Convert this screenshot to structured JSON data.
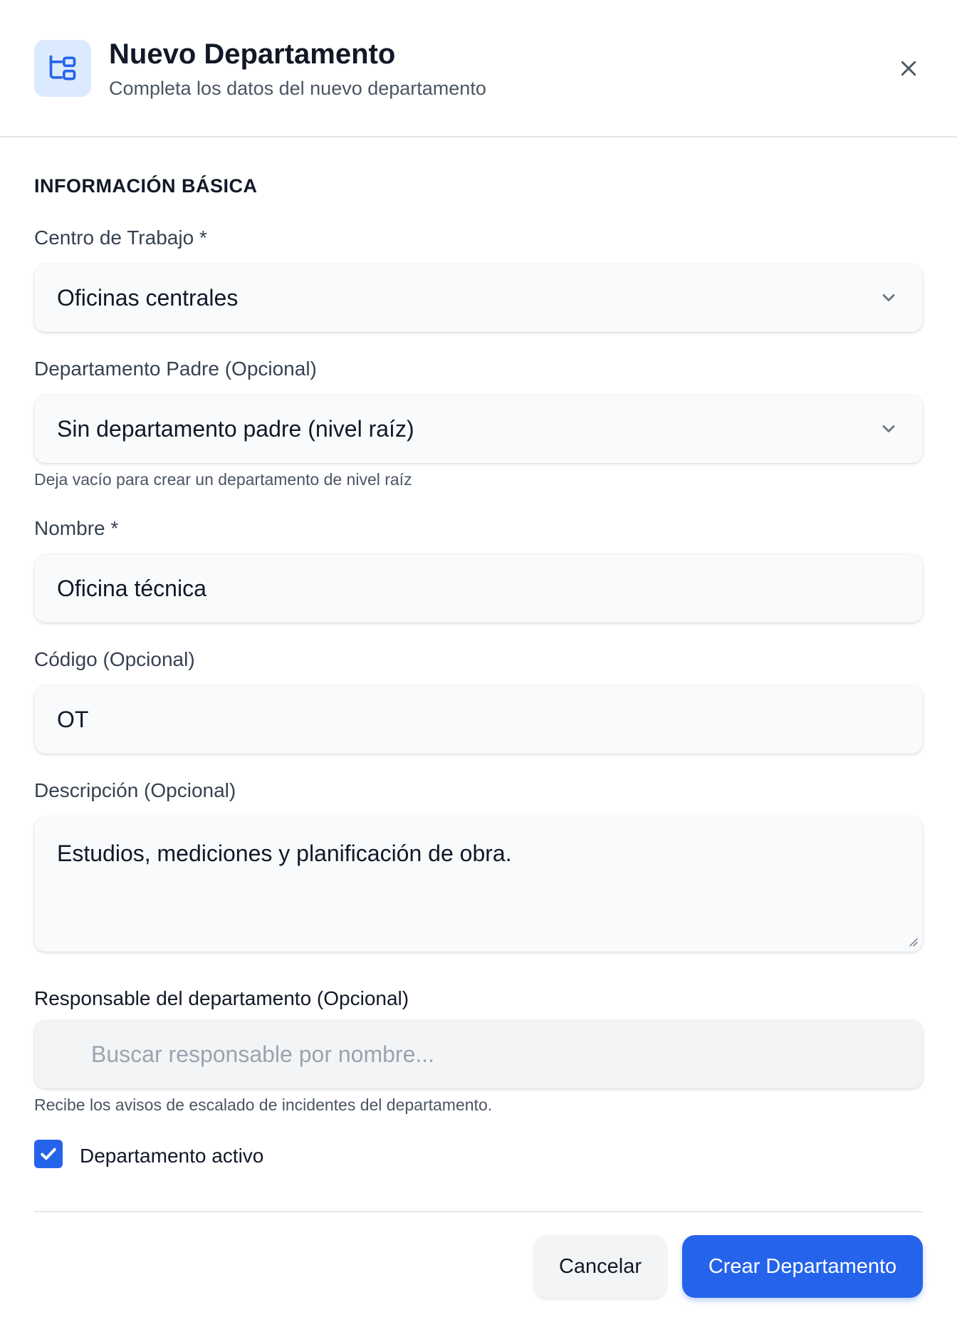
{
  "header": {
    "title": "Nuevo Departamento",
    "subtitle": "Completa los datos del nuevo departamento"
  },
  "section": {
    "title": "INFORMACIÓN BÁSICA"
  },
  "fields": {
    "work_center": {
      "label": "Centro de Trabajo *",
      "value": "Oficinas centrales"
    },
    "parent_department": {
      "label": "Departamento Padre (Opcional)",
      "value": "Sin departamento padre (nivel raíz)",
      "hint": "Deja vacío para crear un departamento de nivel raíz"
    },
    "name": {
      "label": "Nombre *",
      "value": "Oficina técnica"
    },
    "code": {
      "label": "Código (Opcional)",
      "value": "OT"
    },
    "description": {
      "label": "Descripción (Opcional)",
      "value": "Estudios, mediciones y planificación de obra."
    },
    "manager": {
      "label": "Responsable del departamento (Opcional)",
      "placeholder": "Buscar responsable por nombre...",
      "hint": "Recibe los avisos de escalado de incidentes del departamento."
    }
  },
  "active_checkbox": {
    "label": "Departamento activo",
    "checked": true
  },
  "footer": {
    "cancel_label": "Cancelar",
    "submit_label": "Crear Departamento"
  },
  "colors": {
    "accent": "#2563eb",
    "icon_bg": "#dbeafe"
  }
}
